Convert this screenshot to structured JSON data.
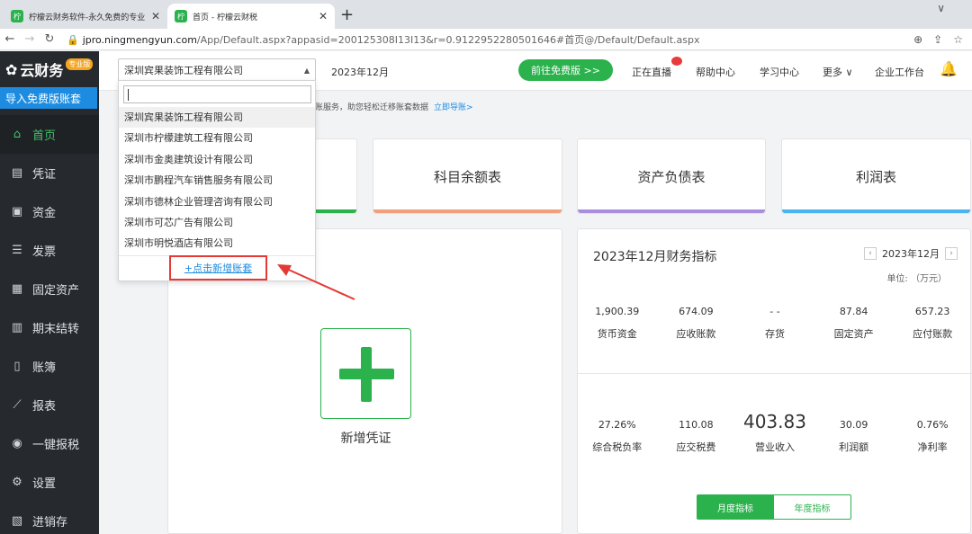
{
  "browser": {
    "tabs": [
      {
        "title": "柠檬云财务软件-永久免费的专业",
        "favicon": "柠",
        "active": false
      },
      {
        "title": "首页 - 柠檬云财税",
        "favicon": "柠",
        "active": true
      }
    ],
    "url_host": "jpro.ningmengyun.com",
    "url_rest": "/App/Default.aspx?appasid=200125308I13I13&r=0.9122952280501646#首页@/Default/Default.aspx"
  },
  "sidebar": {
    "logo_text": "云财务",
    "edition_badge": "专业版",
    "import_button": "导入免费版账套",
    "items": [
      {
        "label": "首页",
        "icon": "home-icon",
        "glyph": "⌂",
        "active": true
      },
      {
        "label": "凭证",
        "icon": "voucher-icon",
        "glyph": "▤",
        "active": false
      },
      {
        "label": "资金",
        "icon": "fund-icon",
        "glyph": "▣",
        "active": false
      },
      {
        "label": "发票",
        "icon": "invoice-icon",
        "glyph": "☰",
        "active": false
      },
      {
        "label": "固定资产",
        "icon": "fixed-asset-icon",
        "glyph": "▦",
        "active": false
      },
      {
        "label": "期末结转",
        "icon": "period-close-icon",
        "glyph": "▥",
        "active": false
      },
      {
        "label": "账簿",
        "icon": "ledger-book-icon",
        "glyph": "▯",
        "active": false
      },
      {
        "label": "报表",
        "icon": "report-chart-icon",
        "glyph": "⟋",
        "active": false
      },
      {
        "label": "一键报税",
        "icon": "tax-filing-icon",
        "glyph": "◉",
        "active": false
      },
      {
        "label": "设置",
        "icon": "settings-gear-icon",
        "glyph": "⚙",
        "active": false
      },
      {
        "label": "进销存",
        "icon": "inventory-icon",
        "glyph": "▧",
        "active": false
      }
    ]
  },
  "header": {
    "company_selected": "深圳宾果装饰工程有限公司",
    "period": "2023年12月",
    "free_button": "前往免费版 >>",
    "nav": [
      "正在直播",
      "帮助中心",
      "学习中心",
      "更多 ∨",
      "企业工作台"
    ]
  },
  "notice": {
    "text": "账服务，助您轻松迁移账套数据",
    "link": "立即导账>"
  },
  "dropdown": {
    "search_value": "",
    "companies": [
      "深圳宾果装饰工程有限公司",
      "深圳市柠檬建筑工程有限公司",
      "深圳市金奥建筑设计有限公司",
      "深圳市鹏程汽车销售服务有限公司",
      "深圳市德林企业管理咨询有限公司",
      "深圳市可芯广告有限公司",
      "深圳市明悦酒店有限公司"
    ],
    "add_ledger": "+点击新增账套"
  },
  "report_cards": [
    {
      "label": "科目余额表",
      "accent": "#f0a07a"
    },
    {
      "label": "资产负债表",
      "accent": "#a98de0"
    },
    {
      "label": "利润表",
      "accent": "#4ab3f0"
    }
  ],
  "first_card_accent": "#2bb24c",
  "voucher": {
    "label": "新增凭证"
  },
  "finance": {
    "title": "2023年12月财务指标",
    "month": "2023年12月",
    "unit": "单位: （万元）",
    "row1": [
      {
        "value": "1,900.39",
        "label": "货币资金"
      },
      {
        "value": "674.09",
        "label": "应收账款"
      },
      {
        "value": "- -",
        "label": "存货"
      },
      {
        "value": "87.84",
        "label": "固定资产"
      },
      {
        "value": "657.23",
        "label": "应付账款"
      }
    ],
    "row2": [
      {
        "value": "27.26%",
        "label": "综合税负率"
      },
      {
        "value": "110.08",
        "label": "应交税费"
      },
      {
        "value": "403.83",
        "label": "营业收入"
      },
      {
        "value": "30.09",
        "label": "利润额"
      },
      {
        "value": "0.76%",
        "label": "净利率"
      }
    ],
    "toggle": {
      "monthly": "月度指标",
      "yearly": "年度指标"
    }
  },
  "colors": {
    "brand_green": "#2bb24c",
    "link_blue": "#1d8ce0",
    "highlight_red": "#e53935"
  }
}
